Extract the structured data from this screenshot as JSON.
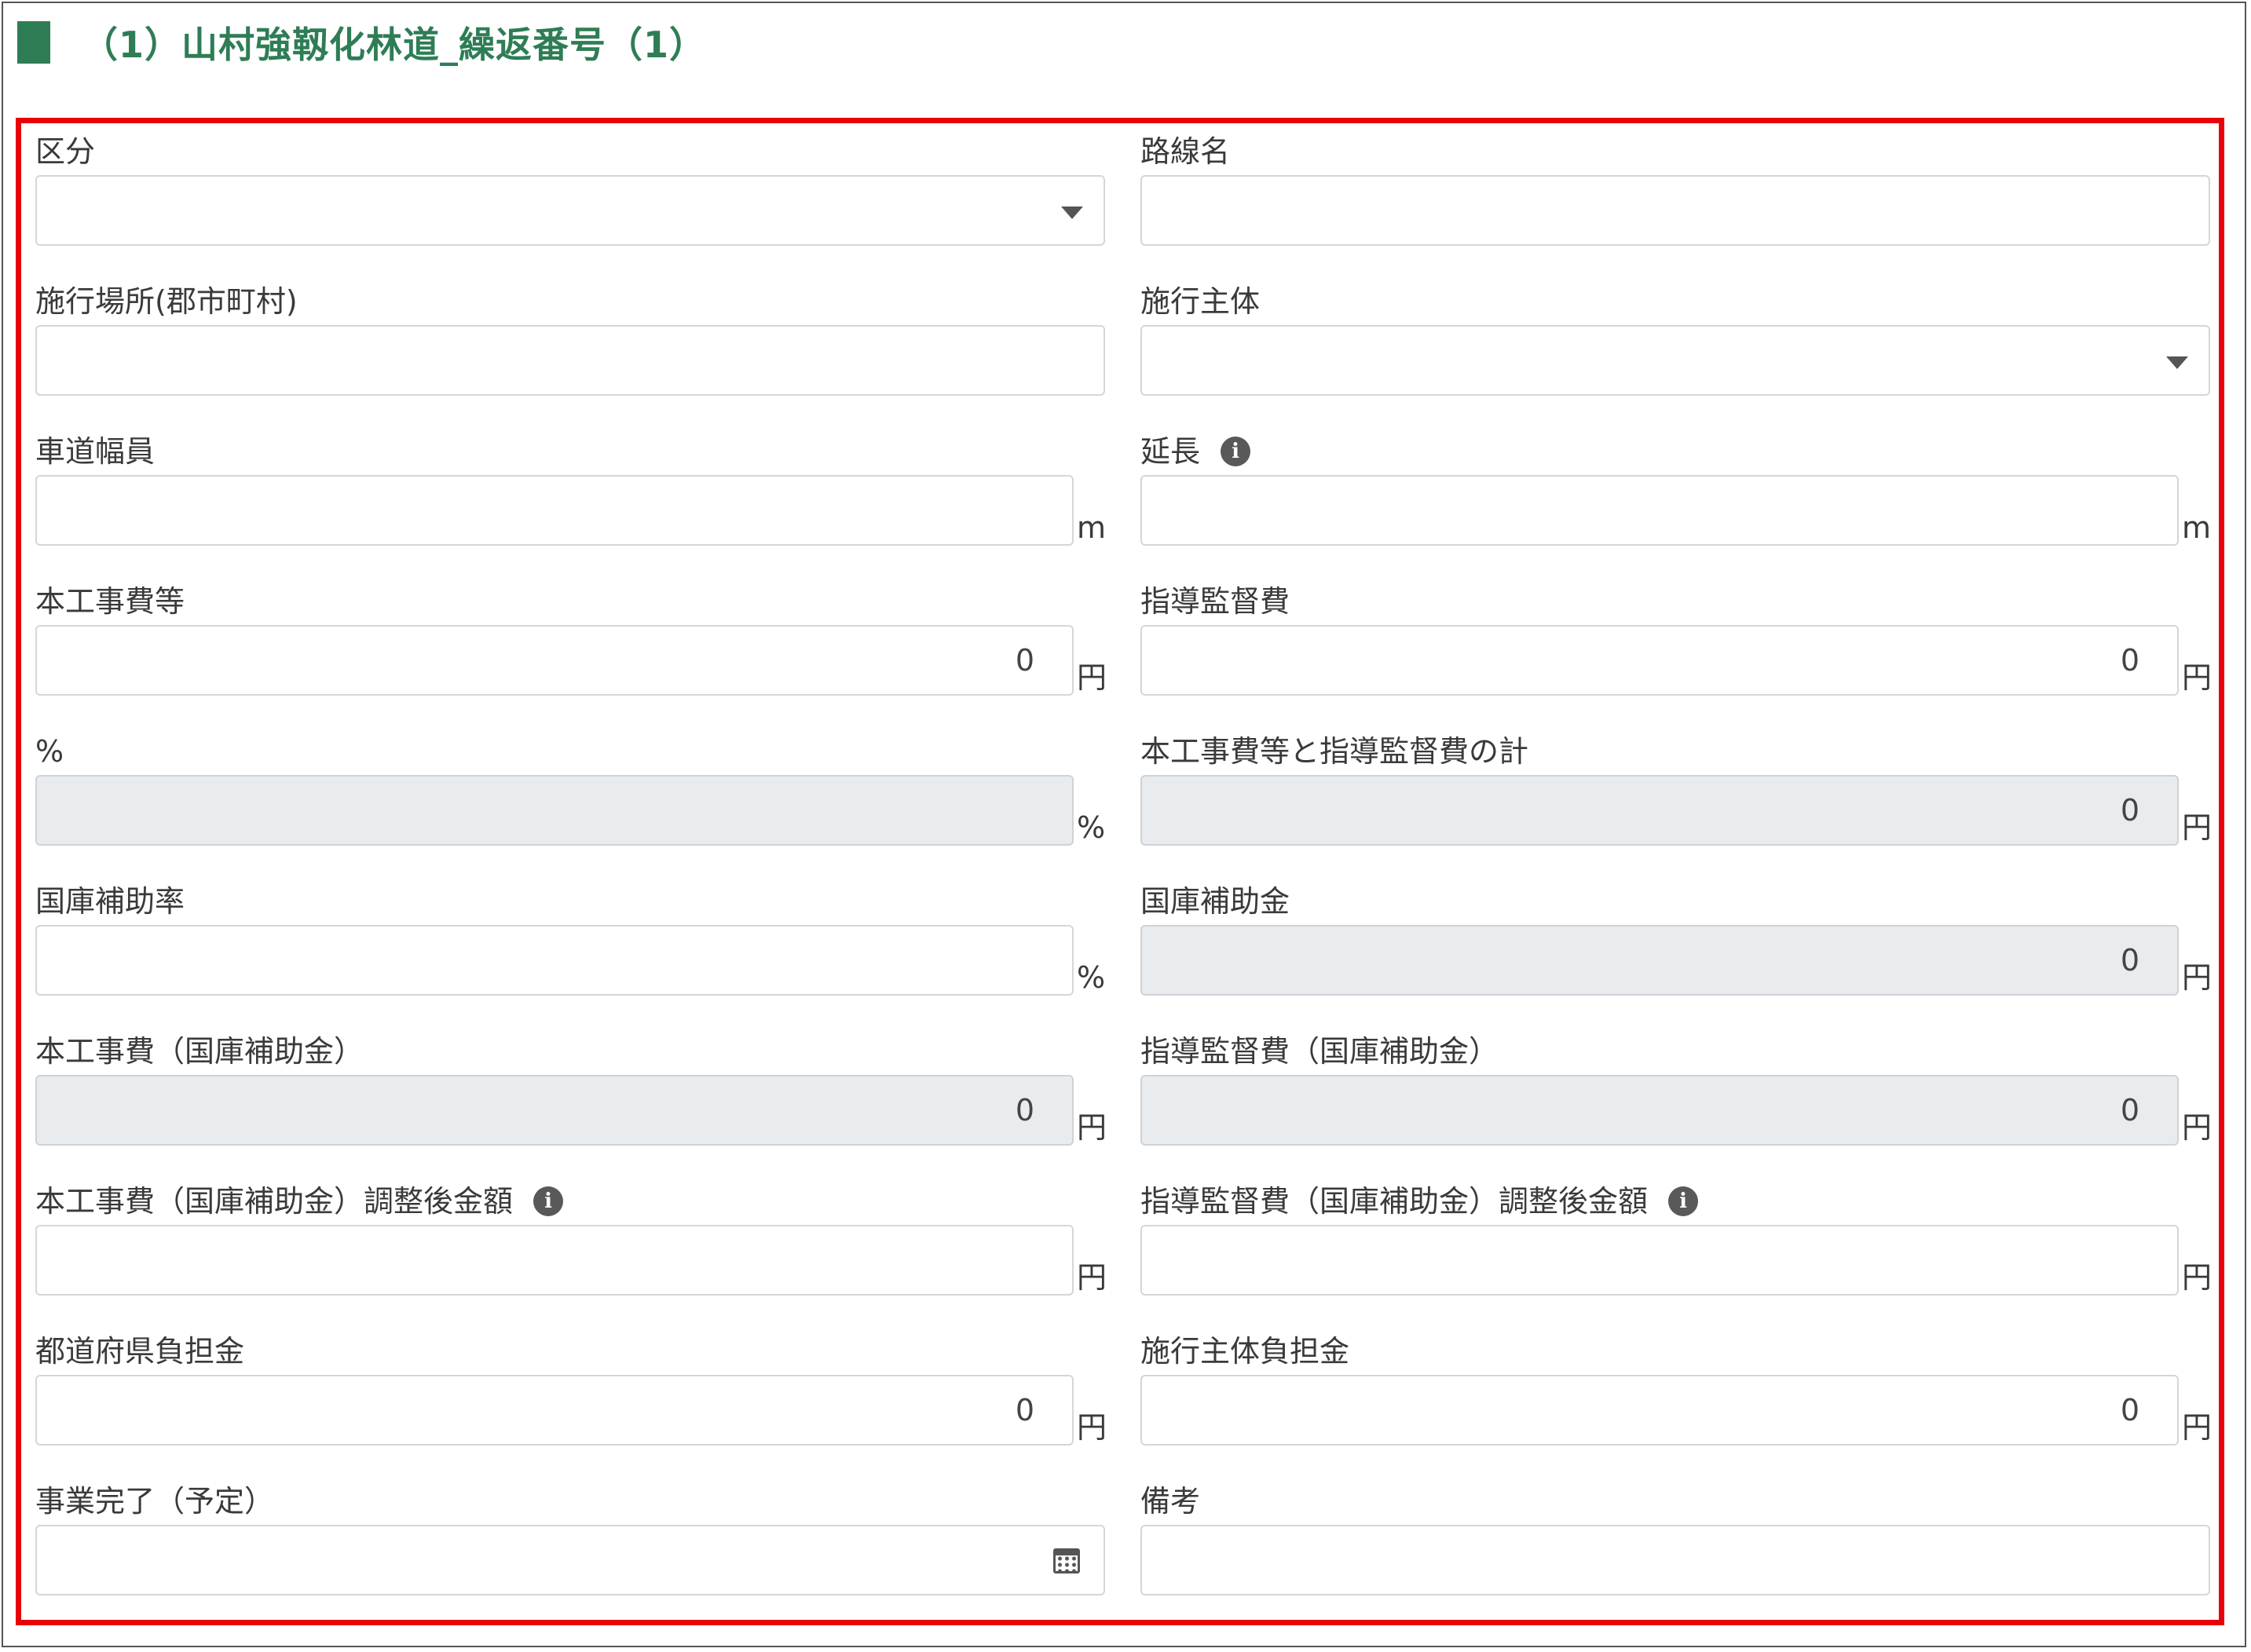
{
  "section": {
    "title": "（1）山村強靱化林道_繰返番号（1）"
  },
  "colors": {
    "accent": "#2e7d55",
    "highlight": "#e8000b",
    "readonly_bg": "#e9ecef"
  },
  "fields": [
    {
      "key": "kubun",
      "label": "区分",
      "type": "select",
      "value": "",
      "unit": "",
      "readonly": false,
      "info": false
    },
    {
      "key": "rosenmei",
      "label": "路線名",
      "type": "text",
      "value": "",
      "unit": "",
      "readonly": false,
      "info": false
    },
    {
      "key": "sekou_basho",
      "label": "施行場所(郡市町村)",
      "type": "text",
      "value": "",
      "unit": "",
      "readonly": false,
      "info": false
    },
    {
      "key": "sekou_shutai",
      "label": "施行主体",
      "type": "select",
      "value": "",
      "unit": "",
      "readonly": false,
      "info": false
    },
    {
      "key": "shadou_fukuin",
      "label": "車道幅員",
      "type": "number",
      "value": "",
      "unit": "m",
      "readonly": false,
      "info": false
    },
    {
      "key": "enchou",
      "label": "延長",
      "type": "number",
      "value": "",
      "unit": "m",
      "readonly": false,
      "info": true
    },
    {
      "key": "hon_kouji_hi",
      "label": "本工事費等",
      "type": "number",
      "value": "0",
      "unit": "円",
      "readonly": false,
      "info": false
    },
    {
      "key": "shidou_kantoku_hi",
      "label": "指導監督費",
      "type": "number",
      "value": "0",
      "unit": "円",
      "readonly": false,
      "info": false
    },
    {
      "key": "percent",
      "label": "%",
      "type": "number",
      "value": "",
      "unit": "%",
      "readonly": true,
      "info": false
    },
    {
      "key": "total",
      "label": "本工事費等と指導監督費の計",
      "type": "number",
      "value": "0",
      "unit": "円",
      "readonly": true,
      "info": false
    },
    {
      "key": "kokko_hojo_ritsu",
      "label": "国庫補助率",
      "type": "number",
      "value": "",
      "unit": "%",
      "readonly": false,
      "info": false
    },
    {
      "key": "kokko_hojo_kin",
      "label": "国庫補助金",
      "type": "number",
      "value": "0",
      "unit": "円",
      "readonly": true,
      "info": false
    },
    {
      "key": "hon_kouji_kokko",
      "label": "本工事費（国庫補助金）",
      "type": "number",
      "value": "0",
      "unit": "円",
      "readonly": true,
      "info": false
    },
    {
      "key": "shidou_kokko",
      "label": "指導監督費（国庫補助金）",
      "type": "number",
      "value": "0",
      "unit": "円",
      "readonly": true,
      "info": false
    },
    {
      "key": "hon_kouji_kokko_chousei",
      "label": "本工事費（国庫補助金）調整後金額",
      "type": "number",
      "value": "",
      "unit": "円",
      "readonly": false,
      "info": true
    },
    {
      "key": "shidou_kokko_chousei",
      "label": "指導監督費（国庫補助金）調整後金額",
      "type": "number",
      "value": "",
      "unit": "円",
      "readonly": false,
      "info": true
    },
    {
      "key": "todoufuken_futan",
      "label": "都道府県負担金",
      "type": "number",
      "value": "0",
      "unit": "円",
      "readonly": false,
      "info": false
    },
    {
      "key": "sekou_shutai_futan",
      "label": "施行主体負担金",
      "type": "number",
      "value": "0",
      "unit": "円",
      "readonly": false,
      "info": false
    },
    {
      "key": "jigyou_kanryou",
      "label": "事業完了（予定）",
      "type": "date",
      "value": "",
      "unit": "",
      "readonly": false,
      "info": false
    },
    {
      "key": "bikou",
      "label": "備考",
      "type": "text",
      "value": "",
      "unit": "",
      "readonly": false,
      "info": false
    }
  ]
}
